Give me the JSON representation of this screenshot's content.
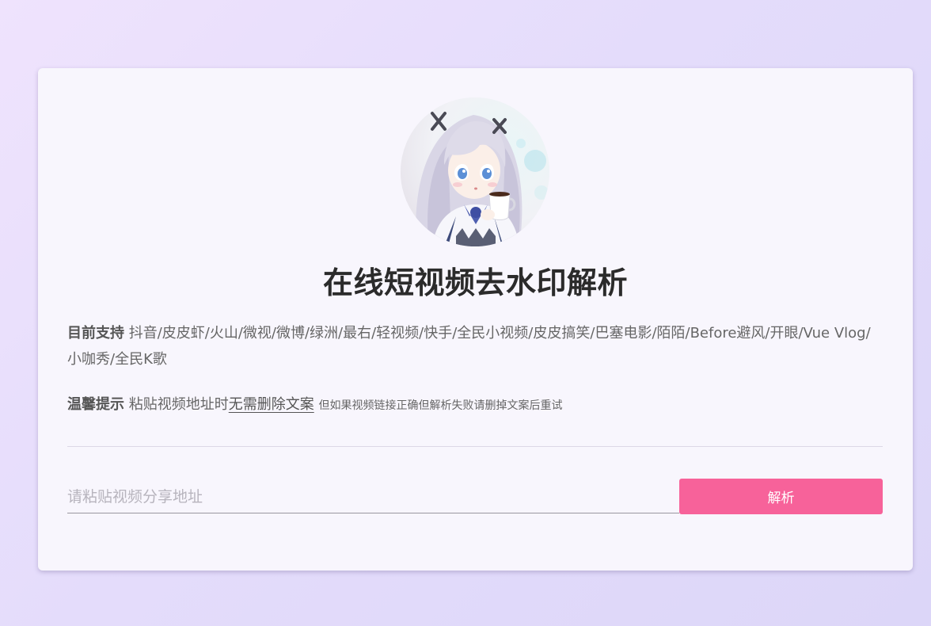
{
  "header": {
    "avatar_icon": "anime-girl-avatar-icon",
    "title": "在线短视频去水印解析"
  },
  "support": {
    "label": "目前支持",
    "platforms": "抖音/皮皮虾/火山/微视/微博/绿洲/最右/轻视频/快手/全民小视频/皮皮搞笑/巴塞电影/陌陌/Before避风/开眼/Vue Vlog/小咖秀/全民K歌"
  },
  "tip": {
    "label": "温馨提示",
    "text": "粘贴视频地址时",
    "emphasis": "无需删除文案",
    "note": "但如果视频链接正确但解析失败请删掉文案后重试"
  },
  "form": {
    "url_placeholder": "请粘贴视频分享地址",
    "url_value": "",
    "submit_label": "解析"
  },
  "colors": {
    "accent": "#f7629a",
    "card_background": "#f8f6fd",
    "page_gradient_start": "#efe3fd",
    "page_gradient_end": "#dcd6f8"
  }
}
